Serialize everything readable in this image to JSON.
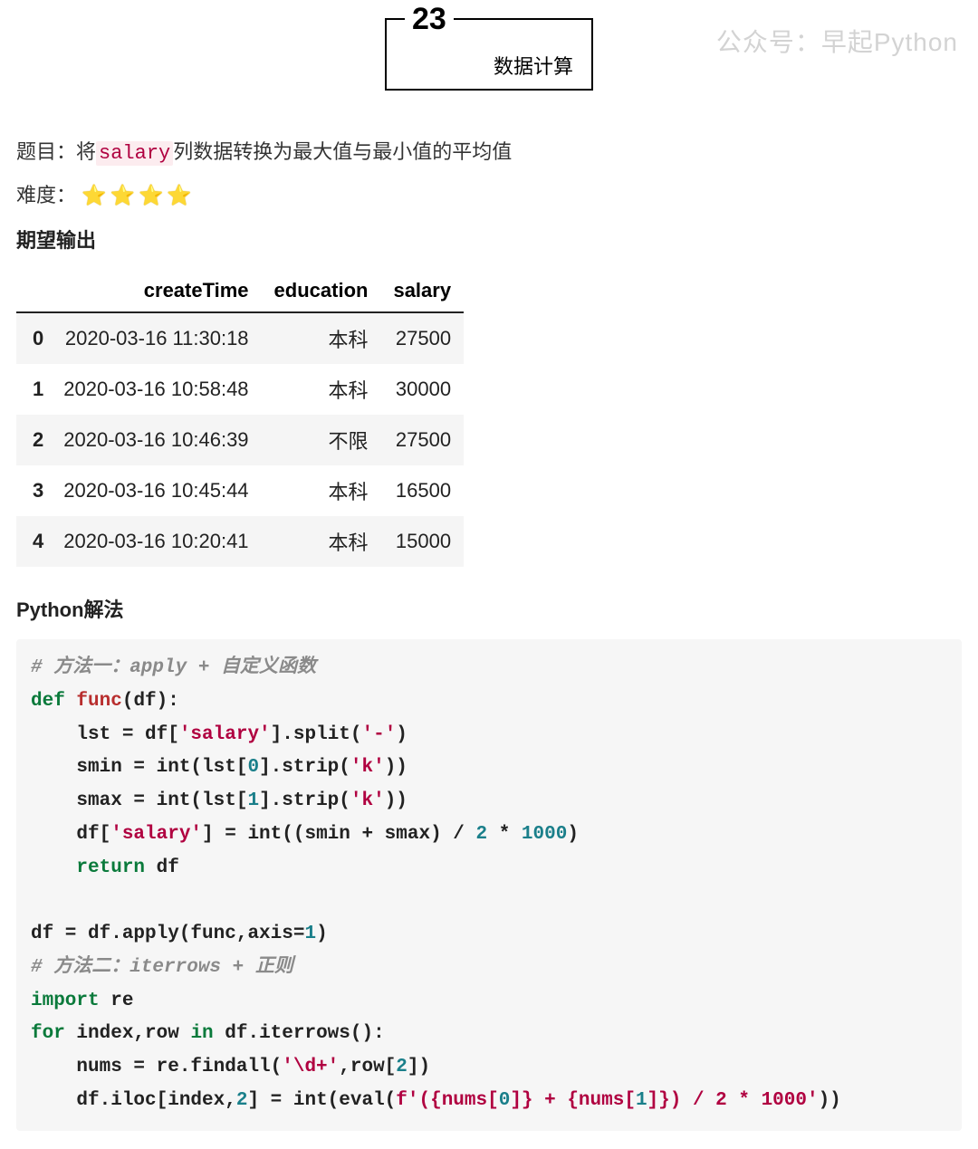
{
  "watermark": "公众号：早起Python",
  "title": {
    "number": "23",
    "text": "数据计算"
  },
  "problem": {
    "label": "题目：",
    "prefix": "将",
    "inline_code": "salary",
    "suffix": "列数据转换为最大值与最小值的平均值"
  },
  "difficulty": {
    "label": "难度：",
    "stars": 4
  },
  "expected_output_label": "期望输出",
  "table": {
    "columns": [
      "",
      "createTime",
      "education",
      "salary"
    ],
    "rows": [
      [
        "0",
        "2020-03-16 11:30:18",
        "本科",
        "27500"
      ],
      [
        "1",
        "2020-03-16 10:58:48",
        "本科",
        "30000"
      ],
      [
        "2",
        "2020-03-16 10:46:39",
        "不限",
        "27500"
      ],
      [
        "3",
        "2020-03-16 10:45:44",
        "本科",
        "16500"
      ],
      [
        "4",
        "2020-03-16 10:20:41",
        "本科",
        "15000"
      ]
    ]
  },
  "solution_label": "Python解法",
  "code": {
    "line1_comment": "# 方法一：apply + 自定义函数",
    "line2": {
      "kw": "def",
      "fn": "func",
      "rest": "(df):"
    },
    "line3": "    lst = df['salary'].split('-')",
    "line3_parts": {
      "a": "    lst = df[",
      "s1": "'salary'",
      "b": "].split(",
      "s2": "'-'",
      "c": ")"
    },
    "line4": {
      "a": "    smin = int(lst[",
      "n1": "0",
      "b": "].strip(",
      "s1": "'k'",
      "c": "))"
    },
    "line5": {
      "a": "    smax = int(lst[",
      "n1": "1",
      "b": "].strip(",
      "s1": "'k'",
      "c": "))"
    },
    "line6": {
      "a": "    df[",
      "s1": "'salary'",
      "b": "] = int((smin + smax) / ",
      "n1": "2",
      "c": " * ",
      "n2": "1000",
      "d": ")"
    },
    "line7": {
      "kw": "return",
      "rest": " df"
    },
    "line8": "",
    "line9": {
      "a": "df = df.apply(func,axis=",
      "n1": "1",
      "b": ")"
    },
    "line10_comment": "# 方法二：iterrows + 正则",
    "line11": {
      "kw": "import",
      "rest": " re"
    },
    "line12": {
      "kw1": "for",
      "a": " index,row ",
      "kw2": "in",
      "b": " df.iterrows():"
    },
    "line13": {
      "a": "    nums = re.findall(",
      "s1": "'\\d+'",
      "b": ",row[",
      "n1": "2",
      "c": "])"
    },
    "line14": {
      "a": "    df.iloc[index,",
      "n1": "2",
      "b": "] = int(eval(",
      "f1": "f'({nums[",
      "fn1": "0",
      "f2": "]} + {nums[",
      "fn2": "1",
      "f3": "]}) / 2 * 1000'",
      "c": "))"
    }
  }
}
